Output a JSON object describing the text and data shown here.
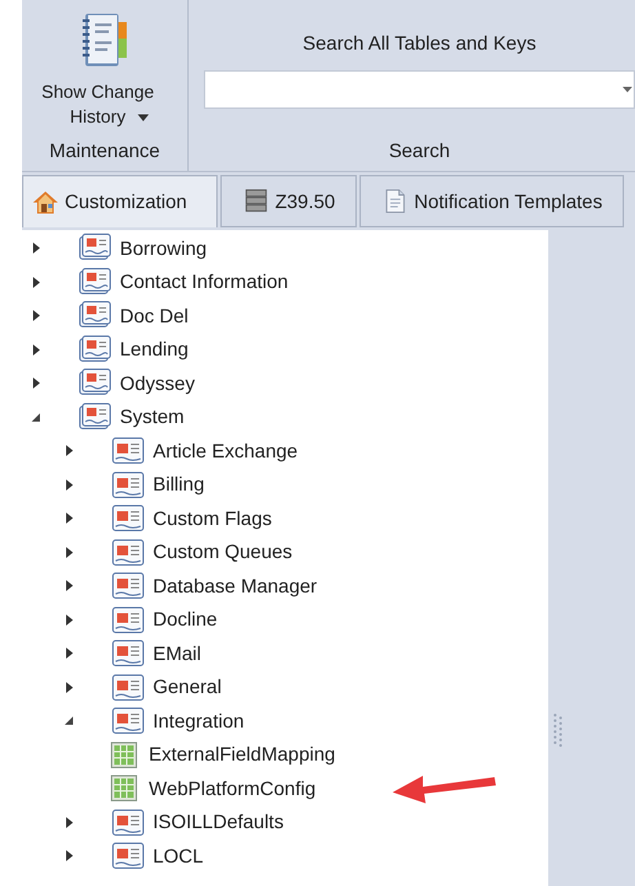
{
  "ribbon": {
    "maintenance": {
      "button": {
        "label": "Show Change History",
        "dropdown": true
      },
      "group_label": "Maintenance"
    },
    "search": {
      "title": "Search All Tables and Keys",
      "group_label": "Search"
    }
  },
  "tabs": [
    {
      "label": "Customization",
      "kind": "house",
      "selected": true
    },
    {
      "label": "Z39.50",
      "kind": "database",
      "selected": false
    },
    {
      "label": "Notification Templates",
      "kind": "document",
      "selected": false
    }
  ],
  "tree": [
    {
      "label": "Borrowing",
      "kind": "folder",
      "expanded": false
    },
    {
      "label": "Contact Information",
      "kind": "folder",
      "expanded": false
    },
    {
      "label": "Doc Del",
      "kind": "folder",
      "expanded": false
    },
    {
      "label": "Lending",
      "kind": "folder",
      "expanded": false
    },
    {
      "label": "Odyssey",
      "kind": "folder",
      "expanded": false
    },
    {
      "label": "System",
      "kind": "folder",
      "expanded": true,
      "children": [
        {
          "label": "Article Exchange",
          "kind": "section",
          "expanded": false
        },
        {
          "label": "Billing",
          "kind": "section",
          "expanded": false
        },
        {
          "label": "Custom Flags",
          "kind": "section",
          "expanded": false
        },
        {
          "label": "Custom Queues",
          "kind": "section",
          "expanded": false
        },
        {
          "label": "Database Manager",
          "kind": "section",
          "expanded": false
        },
        {
          "label": "Docline",
          "kind": "section",
          "expanded": false
        },
        {
          "label": "EMail",
          "kind": "section",
          "expanded": false
        },
        {
          "label": "General",
          "kind": "section",
          "expanded": false
        },
        {
          "label": "Integration",
          "kind": "section",
          "expanded": true,
          "children": [
            {
              "label": "ExternalFieldMapping",
              "kind": "table"
            },
            {
              "label": "WebPlatformConfig",
              "kind": "table"
            }
          ]
        },
        {
          "label": "ISOILLDefaults",
          "kind": "section",
          "expanded": false
        },
        {
          "label": "LOCL",
          "kind": "section",
          "expanded": false
        }
      ]
    }
  ]
}
